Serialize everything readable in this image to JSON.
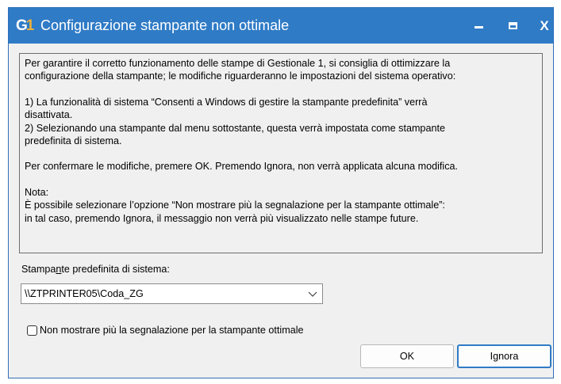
{
  "window": {
    "title": "Configurazione stampante non ottimale",
    "app_icon_text": "G",
    "app_icon_number": "1",
    "title_bar_color": "#2f7bc6",
    "controls": {
      "minimize_icon": "minimize-icon",
      "maximize_icon": "maximize-icon",
      "close_glyph": "X"
    }
  },
  "message": {
    "intro": "Per garantire il corretto funzionamento delle stampe di Gestionale 1, si consiglia di ottimizzare la\nconfigurazione della stampante; le modifiche riguarderanno le impostazioni del sistema operativo:",
    "point1": "1) La funzionalità di sistema “Consenti a Windows di gestire la stampante predefinita” verrà\ndisattivata.",
    "point2": "2) Selezionando una stampante dal menu sottostante, questa verrà impostata come stampante\npredefinita di sistema.",
    "confirm": "Per confermare le modifiche, premere OK. Premendo Ignora, non verrà applicata alcuna modifica.",
    "note_title": "Nota:",
    "note_body": "È possibile selezionare l’opzione “Non mostrare più la segnalazione per la stampante ottimale”:\nin tal caso, premendo Ignora, il messaggio non verrà più visualizzato nelle stampe future."
  },
  "printer": {
    "label_before": "Stampa",
    "label_accel": "n",
    "label_after": "te predefinita di sistema:",
    "selected": "\\\\ZTPRINTER05\\Coda_ZG"
  },
  "checkbox": {
    "label": "Non mostrare più la segnalazione per la stampante ottimale",
    "checked": false
  },
  "buttons": {
    "ok": "OK",
    "ignore": "Ignora"
  }
}
